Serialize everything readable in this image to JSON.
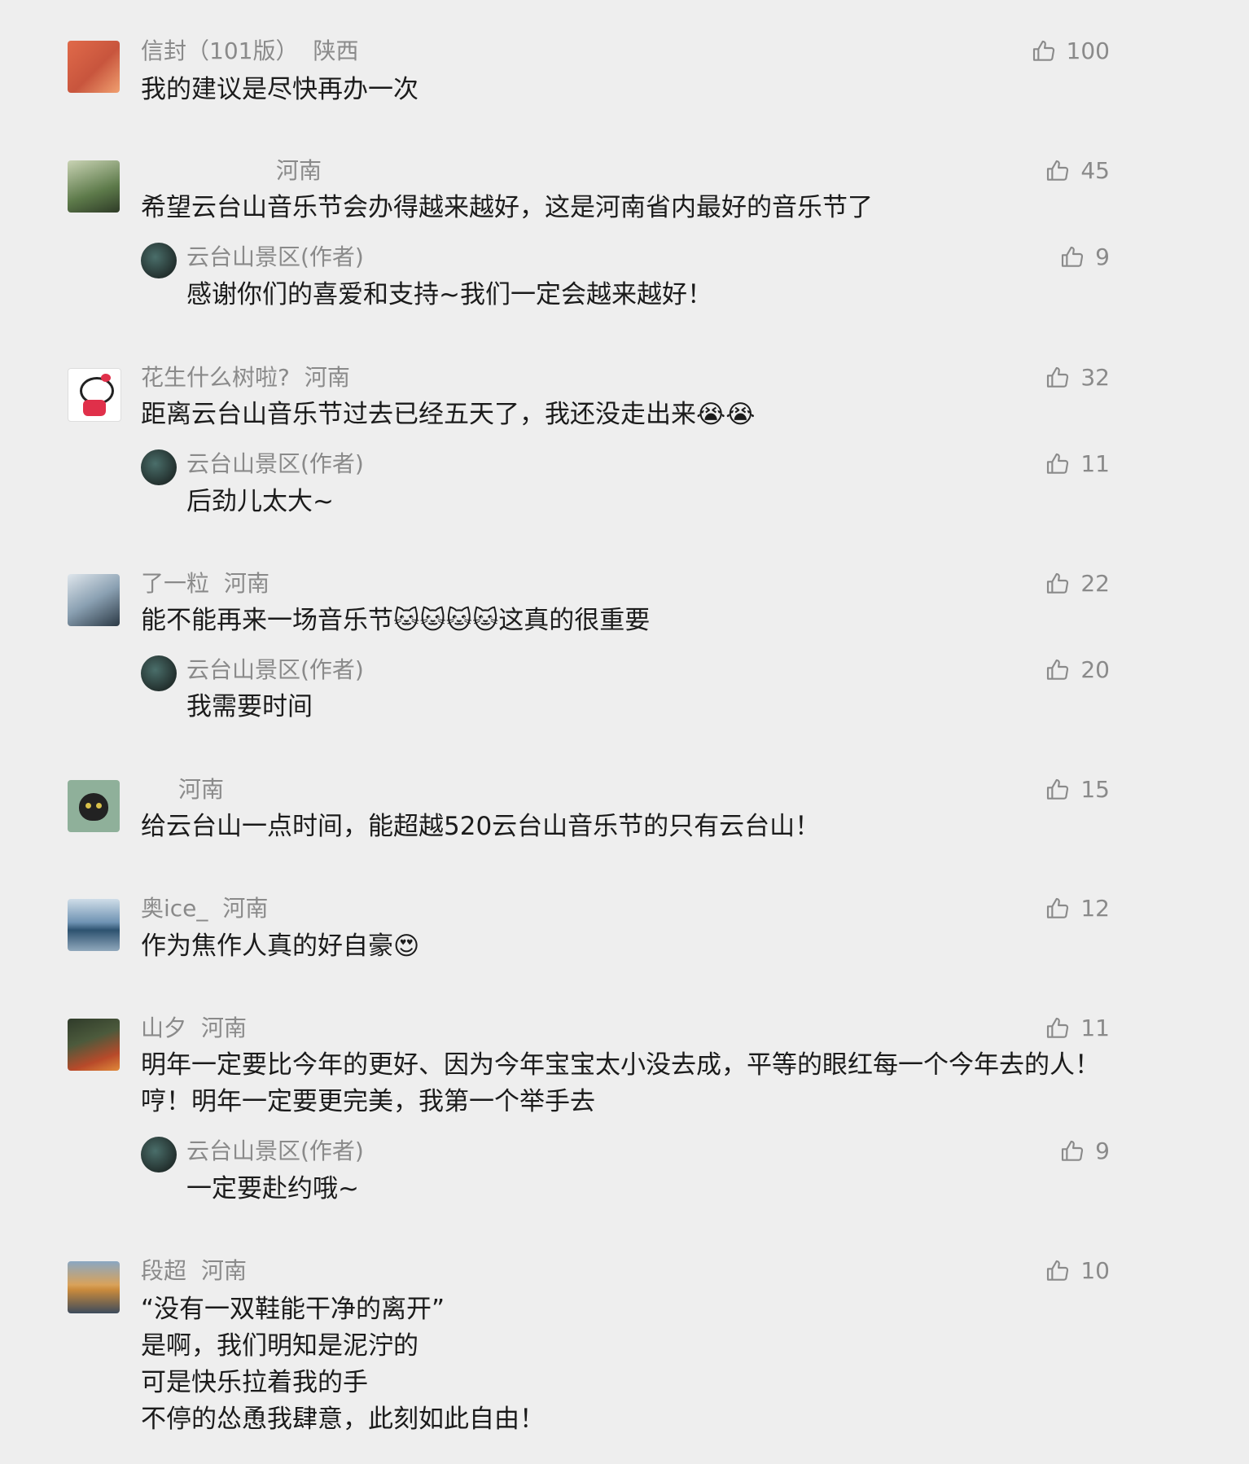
{
  "comments": [
    {
      "user": "信封（101版）",
      "location": "陕西",
      "likes": "100",
      "text": "我的建议是尽快再办一次",
      "avatar_colors": [
        "#c8553d",
        "#e98a5b"
      ]
    },
    {
      "user": "",
      "location": "河南",
      "likes": "45",
      "text": "希望云台山音乐节会办得越来越好，这是河南省内最好的音乐节了",
      "avatar_colors": [
        "#5d7a4a",
        "#c9d3b4"
      ],
      "reply": {
        "user": "云台山景区(作者)",
        "likes": "9",
        "text": "感谢你们的喜爱和支持~我们一定会越来越好！"
      }
    },
    {
      "user": "花生什么树啦?",
      "location": "河南",
      "likes": "32",
      "text": "距离云台山音乐节过去已经五天了，我还没走出来😭😭",
      "avatar_colors": [
        "#ffffff",
        "#e0e0e0"
      ],
      "reply": {
        "user": "云台山景区(作者)",
        "likes": "11",
        "text": "后劲儿太大~"
      }
    },
    {
      "user": "了一粒",
      "location": "河南",
      "likes": "22",
      "text": "能不能再来一场音乐节🐱🐱🐱🐱这真的很重要",
      "avatar_colors": [
        "#3a4a57",
        "#b7c4cf"
      ],
      "reply": {
        "user": "云台山景区(作者)",
        "likes": "20",
        "text": "我需要时间"
      }
    },
    {
      "user": "",
      "location": "河南",
      "likes": "15",
      "text": "给云台山一点时间，能超越520云台山音乐节的只有云台山！",
      "avatar_colors": [
        "#7a9b7e",
        "#2b2b2b"
      ]
    },
    {
      "user": "奥ice_",
      "location": "河南",
      "likes": "12",
      "text": "作为焦作人真的好自豪😍",
      "avatar_colors": [
        "#3d6d95",
        "#cfdde8"
      ]
    },
    {
      "user": "山夕",
      "location": "河南",
      "likes": "11",
      "text": "明年一定要比今年的更好、因为今年宝宝太小没去成，平等的眼红每一个今年去的人！哼！明年一定要更完美，我第一个举手去",
      "avatar_colors": [
        "#2f3b2a",
        "#b84a2a"
      ],
      "reply": {
        "user": "云台山景区(作者)",
        "likes": "9",
        "text": "一定要赴约哦~"
      }
    },
    {
      "user": "段超",
      "location": "河南",
      "likes": "10",
      "text": "“没有一双鞋能干净的离开”\n是啊，我们明知是泥泞的\n可是快乐拉着我的手\n不停的怂恿我肆意，此刻如此自由！",
      "avatar_colors": [
        "#c98a3c",
        "#3d4b5c"
      ]
    }
  ]
}
